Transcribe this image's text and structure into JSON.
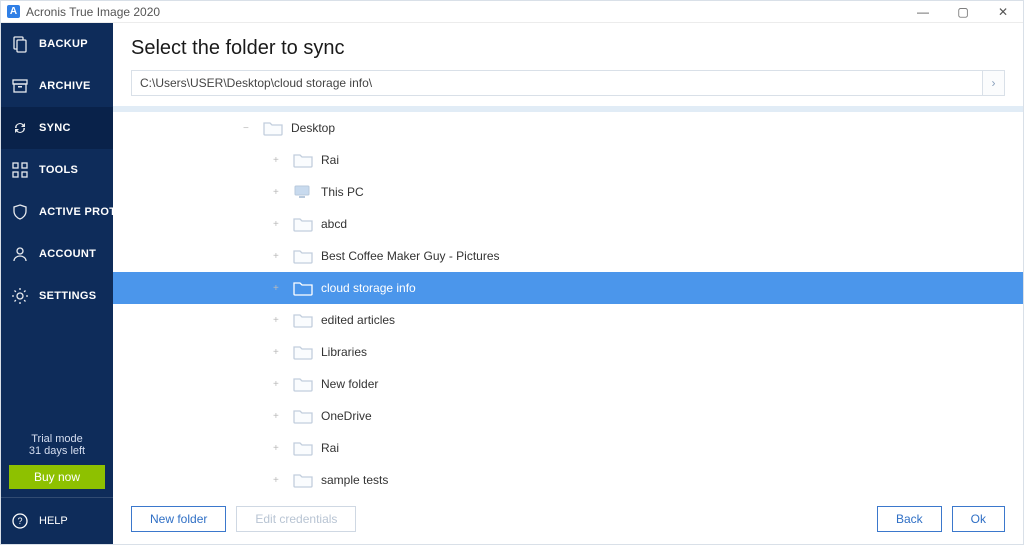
{
  "titlebar": {
    "title": "Acronis True Image 2020"
  },
  "sidebar": {
    "items": [
      {
        "label": "BACKUP"
      },
      {
        "label": "ARCHIVE"
      },
      {
        "label": "SYNC"
      },
      {
        "label": "TOOLS"
      },
      {
        "label": "ACTIVE PROTECTION"
      },
      {
        "label": "ACCOUNT"
      },
      {
        "label": "SETTINGS"
      }
    ],
    "trial_line1": "Trial mode",
    "trial_line2": "31 days left",
    "buy_label": "Buy now",
    "help_label": "HELP"
  },
  "main": {
    "heading": "Select the folder to sync",
    "path": "C:\\Users\\USER\\Desktop\\cloud storage info\\",
    "tree": {
      "root": "Desktop",
      "items": [
        {
          "name": "Rai"
        },
        {
          "name": "This PC"
        },
        {
          "name": "abcd"
        },
        {
          "name": "Best Coffee Maker Guy - Pictures"
        },
        {
          "name": "cloud storage info"
        },
        {
          "name": "edited articles"
        },
        {
          "name": "Libraries"
        },
        {
          "name": "New folder"
        },
        {
          "name": "OneDrive"
        },
        {
          "name": "Rai"
        },
        {
          "name": "sample tests"
        }
      ],
      "selected": "cloud storage info"
    },
    "buttons": {
      "new_folder": "New folder",
      "edit_credentials": "Edit credentials",
      "back": "Back",
      "ok": "Ok"
    }
  }
}
